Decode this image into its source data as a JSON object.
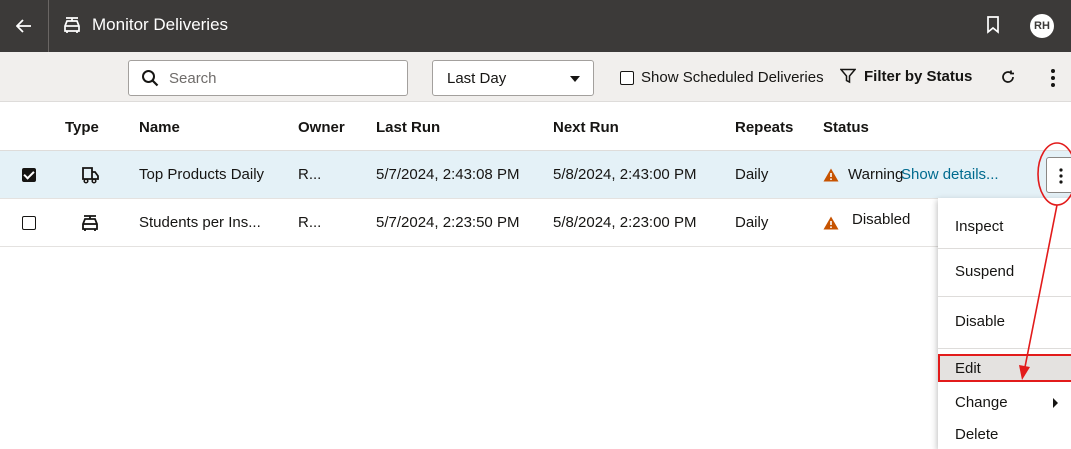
{
  "header": {
    "back_icon": "arrow-left-icon",
    "app_icon": "delivery-car-icon",
    "title": "Monitor Deliveries",
    "bookmark_icon": "bookmark-icon",
    "avatar_initials": "RH"
  },
  "toolbar": {
    "search": {
      "placeholder": "Search",
      "value": ""
    },
    "time_range": {
      "selected": "Last Day"
    },
    "show_scheduled": {
      "label": "Show Scheduled Deliveries",
      "checked": false
    },
    "filter": {
      "label": "Filter by Status",
      "icon": "filter-icon"
    },
    "refresh_icon": "refresh-icon",
    "more_icon": "more-vertical-icon"
  },
  "table": {
    "columns": {
      "type": "Type",
      "name": "Name",
      "owner": "Owner",
      "last_run": "Last Run",
      "next_run": "Next Run",
      "repeats": "Repeats",
      "status": "Status"
    },
    "rows": [
      {
        "selected": true,
        "type_icon": "truck-icon",
        "name": "Top Products Daily",
        "owner": "R...",
        "last_run": "5/7/2024, 2:43:08 PM",
        "next_run": "5/8/2024, 2:43:00 PM",
        "repeats": "Daily",
        "status": "Warning",
        "status_link": "Show details..."
      },
      {
        "selected": false,
        "type_icon": "car-icon",
        "name": "Students per Ins...",
        "owner": "R...",
        "last_run": "5/7/2024, 2:23:50 PM",
        "next_run": "5/8/2024, 2:23:00 PM",
        "repeats": "Daily",
        "status": "Disabled"
      }
    ]
  },
  "context_menu": {
    "items": [
      "Inspect",
      "Suspend",
      "Disable",
      "Edit",
      "Change",
      "Delete"
    ],
    "highlighted": "Edit"
  },
  "colors": {
    "header_bg": "#3c3a39",
    "toolbar_bg": "#f1efed",
    "selected_row_bg": "#e4f1f7",
    "link": "#006b8f",
    "warning": "#c75300",
    "annotation_red": "#e21b1b"
  }
}
